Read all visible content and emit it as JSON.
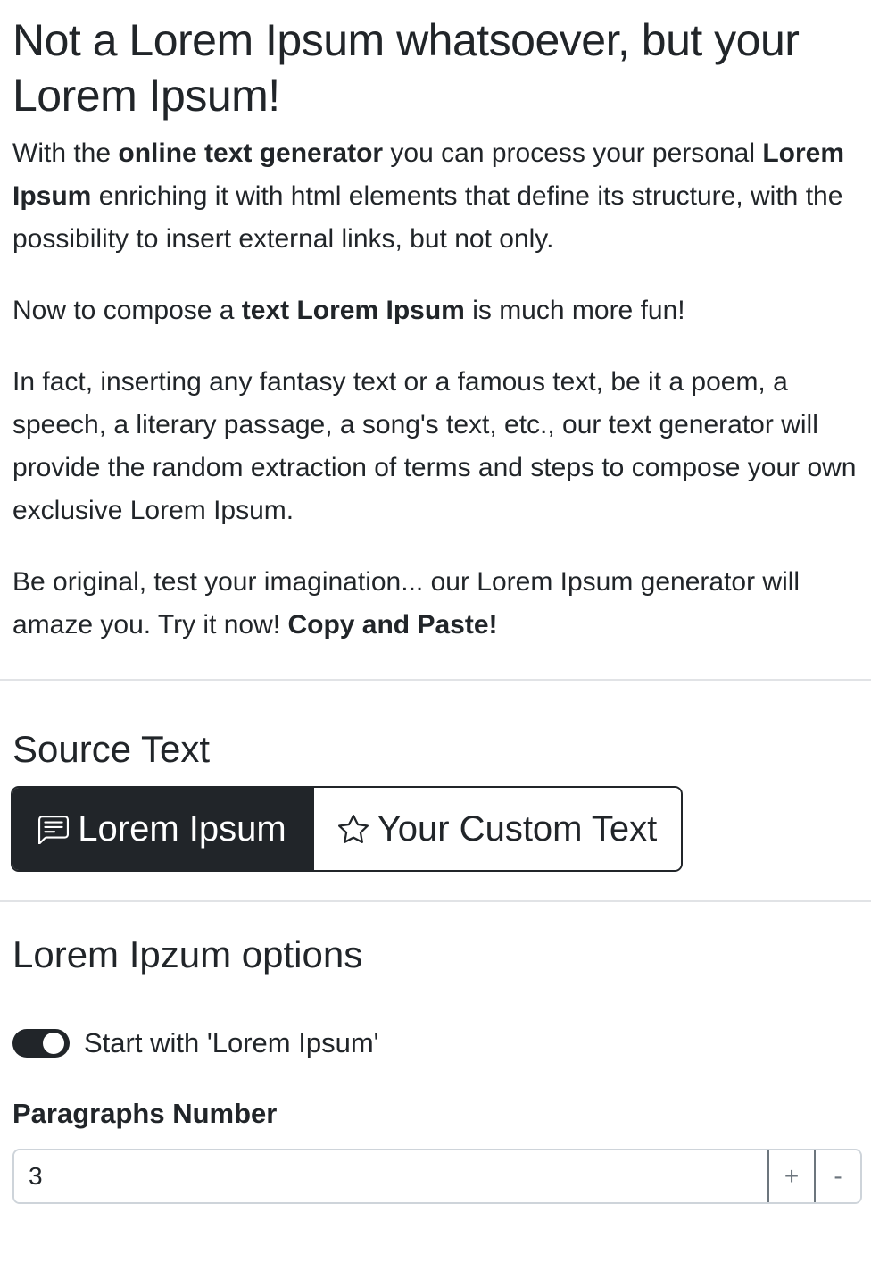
{
  "intro": {
    "title": "Not a Lorem Ipsum whatsoever, but your Lorem Ipsum!",
    "p1": {
      "t1": "With the ",
      "b1": "online text generator",
      "t2": " you can process your personal ",
      "b2": "Lorem Ipsum",
      "t3": " enriching it with html elements that define its structure, with the possibility to insert external links, but not only."
    },
    "p2": {
      "t1": "Now to compose a ",
      "b1": "text Lorem Ipsum",
      "t2": " is much more fun!"
    },
    "p3": "In fact, inserting any fantasy text or a famous text, be it a poem, a speech, a literary passage, a song's text, etc., our text generator will provide the random extraction of terms and steps to compose your own exclusive Lorem Ipsum.",
    "p4": {
      "t1": "Be original, test your imagination... our Lorem Ipsum generator will amaze you. Try it now! ",
      "b1": "Copy and Paste!"
    }
  },
  "source": {
    "title": "Source Text",
    "options": [
      {
        "label": "Lorem Ipsum",
        "icon": "chat-text-icon",
        "active": true
      },
      {
        "label": "Your Custom Text",
        "icon": "star-icon",
        "active": false
      }
    ]
  },
  "options": {
    "title": "Lorem Ipzum options",
    "start_switch": {
      "label": "Start with 'Lorem Ipsum'",
      "checked": true
    },
    "paragraphs": {
      "label": "Paragraphs Number",
      "value": "3",
      "plus": "+",
      "minus": "-"
    }
  },
  "colors": {
    "text": "#212529",
    "dark": "#212529",
    "border": "#ced4da",
    "divider": "#e1e3e6"
  }
}
